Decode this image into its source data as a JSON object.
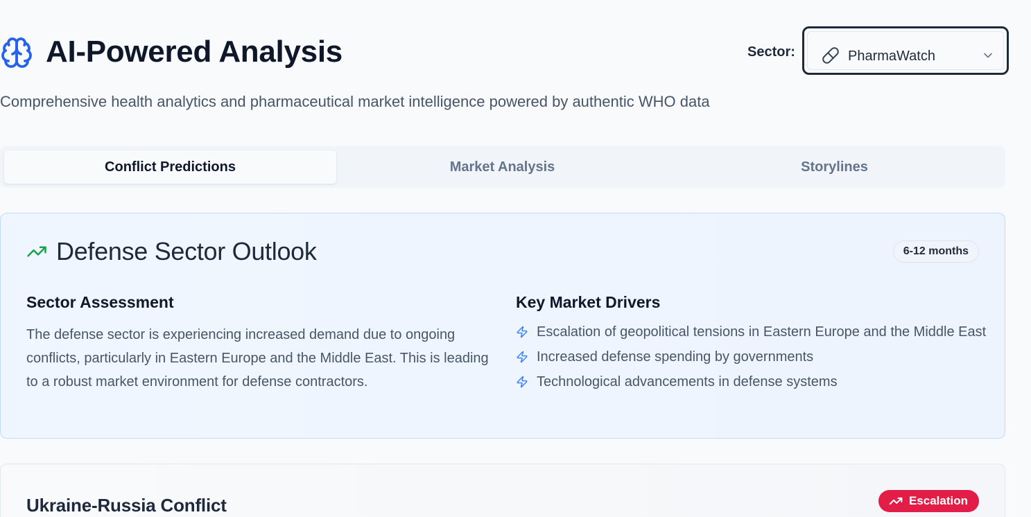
{
  "header": {
    "title": "AI-Powered Analysis",
    "sector_label": "Sector:",
    "sector_value": "PharmaWatch",
    "subtitle": "Comprehensive health analytics and pharmaceutical market intelligence powered by authentic WHO data"
  },
  "tabs": [
    {
      "label": "Conflict Predictions",
      "active": true
    },
    {
      "label": "Market Analysis",
      "active": false
    },
    {
      "label": "Storylines",
      "active": false
    }
  ],
  "outlook": {
    "title": "Defense Sector Outlook",
    "timeframe": "6-12 months",
    "assessment_heading": "Sector Assessment",
    "assessment_text": "The defense sector is experiencing increased demand due to ongoing conflicts, particularly in Eastern Europe and the Middle East. This is leading to a robust market environment for defense contractors.",
    "drivers_heading": "Key Market Drivers",
    "drivers": [
      "Escalation of geopolitical tensions in Eastern Europe and the Middle East",
      "Increased defense spending by governments",
      "Technological advancements in defense systems"
    ]
  },
  "conflict": {
    "title": "Ukraine-Russia Conflict",
    "badge": "Escalation"
  },
  "colors": {
    "accent_blue": "#2563eb",
    "trend_green": "#16a34a",
    "escalation_red": "#e11d48"
  },
  "icons": [
    "brain-icon",
    "pill-icon",
    "chevron-down-icon",
    "trending-up-icon",
    "zap-icon"
  ]
}
